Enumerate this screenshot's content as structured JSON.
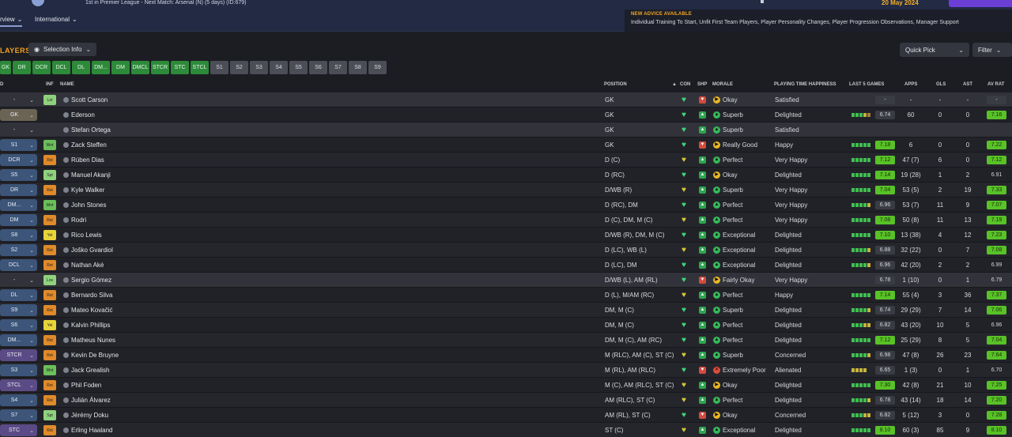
{
  "header": {
    "subtitle": "1st in Premier League - Next Match: Arsenal (N) (5 days) (ID:679)",
    "date": "20 May 2024",
    "tabs": [
      {
        "label": "rview",
        "has_dropdown": true
      },
      {
        "label": "International",
        "has_dropdown": true
      }
    ]
  },
  "advice": {
    "title": "NEW ADVICE AVAILABLE",
    "body": "Individual Training To Start, Unfit First Team Players, Player Personality Changes, Player Progression Observations, Manager Support"
  },
  "toolbar": {
    "title": "LAYERS",
    "selection_info": "Selection Info",
    "quick_pick": "Quick Pick",
    "filter": "Filter"
  },
  "chips": [
    {
      "label": "GK",
      "w": 14,
      "kind": "green"
    },
    {
      "label": "DR",
      "w": 23,
      "kind": "green"
    },
    {
      "label": "DCR",
      "w": 23,
      "kind": "green"
    },
    {
      "label": "DCL",
      "w": 23,
      "kind": "green"
    },
    {
      "label": "DL",
      "w": 23,
      "kind": "green"
    },
    {
      "label": "DM...",
      "w": 23,
      "kind": "green"
    },
    {
      "label": "DM",
      "w": 23,
      "kind": "green"
    },
    {
      "label": "DMCL",
      "w": 23,
      "kind": "green"
    },
    {
      "label": "STCR",
      "w": 23,
      "kind": "green"
    },
    {
      "label": "STC",
      "w": 23,
      "kind": "green"
    },
    {
      "label": "STCL",
      "w": 23,
      "kind": "green"
    },
    {
      "label": "S1",
      "w": 23,
      "kind": "grey"
    },
    {
      "label": "S2",
      "w": 23,
      "kind": "grey"
    },
    {
      "label": "S3",
      "w": 23,
      "kind": "grey"
    },
    {
      "label": "S4",
      "w": 23,
      "kind": "grey"
    },
    {
      "label": "S5",
      "w": 23,
      "kind": "grey"
    },
    {
      "label": "S6",
      "w": 23,
      "kind": "grey"
    },
    {
      "label": "S7",
      "w": 23,
      "kind": "grey"
    },
    {
      "label": "S8",
      "w": 23,
      "kind": "grey"
    },
    {
      "label": "S9",
      "w": 23,
      "kind": "grey"
    }
  ],
  "columns": {
    "sel": "D",
    "inf": "INF",
    "name": "NAME",
    "position": "POSITION",
    "sort": "▲",
    "con": "CON",
    "shp": "SHP",
    "morale": "MORALE",
    "pth": "PLAYING TIME HAPPINESS",
    "last5": "LAST 5 GAMES",
    "apps": "APPS",
    "gls": "GLS",
    "ast": "AST",
    "avrat": "AV RAT"
  },
  "players": [
    {
      "sel": "-",
      "selc": "dark",
      "inf": "Lst",
      "infc": "lgreen",
      "name": "Scott Carson",
      "pos": "GK",
      "con": "g",
      "shp": "down",
      "mc": "ok",
      "morale": "Okay",
      "pth": "Satisfied",
      "form": [],
      "rat": "-",
      "ratc": "mid",
      "apps": "-",
      "gls": "-",
      "ast": "-",
      "av": "-",
      "avc": "mid",
      "hl": true
    },
    {
      "sel": "GK",
      "selc": "grey",
      "inf": "",
      "infc": "",
      "name": "Ederson",
      "pos": "GK",
      "con": "g",
      "shp": "up",
      "mc": "good",
      "morale": "Superb",
      "pth": "Delighted",
      "form": [
        "g",
        "g",
        "g",
        "y",
        "o"
      ],
      "rat": "6.74",
      "ratc": "mid",
      "apps": "60",
      "gls": "0",
      "ast": "0",
      "av": "7.16",
      "avc": "hi"
    },
    {
      "sel": "-",
      "selc": "dark",
      "inf": "",
      "infc": "",
      "name": "Stefan Ortega",
      "pos": "GK",
      "con": "g",
      "shp": "up",
      "mc": "good",
      "morale": "Superb",
      "pth": "Satisfied",
      "form": [],
      "rat": "",
      "ratc": "none",
      "apps": "",
      "gls": "",
      "ast": "",
      "av": "",
      "avc": "none",
      "hl": true
    },
    {
      "sel": "S1",
      "selc": "blue",
      "inf": "Wnt",
      "infc": "green",
      "name": "Zack Steffen",
      "pos": "GK",
      "con": "g",
      "shp": "down",
      "mc": "ok",
      "morale": "Really Good",
      "pth": "Happy",
      "form": [
        "g",
        "g",
        "g",
        "g",
        "g"
      ],
      "rat": "7.18",
      "ratc": "hi",
      "apps": "6",
      "gls": "0",
      "ast": "0",
      "av": "7.22",
      "avc": "hi"
    },
    {
      "sel": "DCR",
      "selc": "blue",
      "inf": "Rst",
      "infc": "orange",
      "name": "Rúben Dias",
      "pos": "D (C)",
      "con": "y",
      "shp": "up",
      "mc": "good",
      "morale": "Perfect",
      "pth": "Very Happy",
      "form": [
        "g",
        "g",
        "g",
        "g",
        "g"
      ],
      "rat": "7.12",
      "ratc": "hi",
      "apps": "47 (7)",
      "gls": "6",
      "ast": "0",
      "av": "7.12",
      "avc": "hi"
    },
    {
      "sel": "S5",
      "selc": "blue",
      "inf": "Spt",
      "infc": "lgreen",
      "name": "Manuel Akanji",
      "pos": "D (RC)",
      "con": "g",
      "shp": "up",
      "mc": "ok",
      "morale": "Okay",
      "pth": "Delighted",
      "form": [
        "g",
        "g",
        "g",
        "g",
        "g"
      ],
      "rat": "7.14",
      "ratc": "hi",
      "apps": "19 (28)",
      "gls": "1",
      "ast": "2",
      "av": "6.91",
      "avc": "plain"
    },
    {
      "sel": "DR",
      "selc": "blue",
      "inf": "Rst",
      "infc": "orange",
      "name": "Kyle Walker",
      "pos": "D/WB (R)",
      "con": "y",
      "shp": "up",
      "mc": "good",
      "morale": "Superb",
      "pth": "Very Happy",
      "form": [
        "g",
        "g",
        "g",
        "g",
        "g"
      ],
      "rat": "7.04",
      "ratc": "hi",
      "apps": "53 (5)",
      "gls": "2",
      "ast": "19",
      "av": "7.33",
      "avc": "hi"
    },
    {
      "sel": "DM...",
      "selc": "blue",
      "inf": "Wnt",
      "infc": "green",
      "name": "John Stones",
      "pos": "D (RC), DM",
      "con": "g",
      "shp": "up",
      "mc": "good",
      "morale": "Perfect",
      "pth": "Very Happy",
      "form": [
        "g",
        "g",
        "g",
        "g",
        "y"
      ],
      "rat": "6.96",
      "ratc": "mid",
      "apps": "53 (7)",
      "gls": "11",
      "ast": "9",
      "av": "7.07",
      "avc": "hi"
    },
    {
      "sel": "DM",
      "selc": "blue",
      "inf": "Rst",
      "infc": "orange",
      "name": "Rodri",
      "pos": "D (C), DM, M (C)",
      "con": "y",
      "shp": "up",
      "mc": "good",
      "morale": "Perfect",
      "pth": "Very Happy",
      "form": [
        "g",
        "g",
        "g",
        "g",
        "g"
      ],
      "rat": "7.08",
      "ratc": "hi",
      "apps": "50 (8)",
      "gls": "11",
      "ast": "13",
      "av": "7.19",
      "avc": "hi"
    },
    {
      "sel": "S8",
      "selc": "blue",
      "inf": "Yel",
      "infc": "yellow",
      "name": "Rico Lewis",
      "pos": "D/WB (R), DM, M (C)",
      "con": "g",
      "shp": "up",
      "mc": "good",
      "morale": "Exceptional",
      "pth": "Delighted",
      "form": [
        "g",
        "g",
        "g",
        "g",
        "g"
      ],
      "rat": "7.10",
      "ratc": "hi",
      "apps": "13 (38)",
      "gls": "4",
      "ast": "12",
      "av": "7.23",
      "avc": "hi"
    },
    {
      "sel": "S2",
      "selc": "blue",
      "inf": "Rst",
      "infc": "orange",
      "name": "Joško Gvardiol",
      "pos": "D (LC), WB (L)",
      "con": "y",
      "shp": "up",
      "mc": "good",
      "morale": "Exceptional",
      "pth": "Delighted",
      "form": [
        "g",
        "g",
        "g",
        "g",
        "y"
      ],
      "rat": "6.88",
      "ratc": "mid",
      "apps": "32 (22)",
      "gls": "0",
      "ast": "7",
      "av": "7.08",
      "avc": "hi"
    },
    {
      "sel": "DCL",
      "selc": "blue",
      "inf": "Rst",
      "infc": "orange",
      "name": "Nathan Aké",
      "pos": "D (LC), DM",
      "con": "g",
      "shp": "up",
      "mc": "good",
      "morale": "Exceptional",
      "pth": "Delighted",
      "form": [
        "g",
        "g",
        "g",
        "g",
        "y"
      ],
      "rat": "6.96",
      "ratc": "mid",
      "apps": "42 (20)",
      "gls": "2",
      "ast": "2",
      "av": "6.99",
      "avc": "plain"
    },
    {
      "sel": "-",
      "selc": "dark",
      "inf": "Los",
      "infc": "lgreen",
      "name": "Sergio Gómez",
      "pos": "D/WB (L), AM (RL)",
      "con": "g",
      "shp": "down",
      "mc": "ok",
      "morale": "Fairly Okay",
      "pth": "Very Happy",
      "form": [],
      "rat": "6.78",
      "ratc": "mid",
      "apps": "1 (10)",
      "gls": "0",
      "ast": "1",
      "av": "6.79",
      "avc": "plain",
      "hl": true
    },
    {
      "sel": "DL",
      "selc": "blue",
      "inf": "Rst",
      "infc": "orange",
      "name": "Bernardo Silva",
      "pos": "D (L), M/AM (RC)",
      "con": "y",
      "shp": "up",
      "mc": "good",
      "morale": "Perfect",
      "pth": "Happy",
      "form": [
        "g",
        "g",
        "g",
        "g",
        "g"
      ],
      "rat": "7.14",
      "ratc": "hi",
      "apps": "55 (4)",
      "gls": "3",
      "ast": "36",
      "av": "7.37",
      "avc": "hi"
    },
    {
      "sel": "S9",
      "selc": "blue",
      "inf": "Rst",
      "infc": "orange",
      "name": "Mateo Kovačić",
      "pos": "DM, M (C)",
      "con": "g",
      "shp": "up",
      "mc": "good",
      "morale": "Superb",
      "pth": "Delighted",
      "form": [
        "g",
        "g",
        "g",
        "g",
        "y"
      ],
      "rat": "6.74",
      "ratc": "mid",
      "apps": "29 (29)",
      "gls": "7",
      "ast": "14",
      "av": "7.06",
      "avc": "hi"
    },
    {
      "sel": "S6",
      "selc": "blue",
      "inf": "Yel",
      "infc": "yellow",
      "name": "Kalvin Phillips",
      "pos": "DM, M (C)",
      "con": "g",
      "shp": "up",
      "mc": "good",
      "morale": "Perfect",
      "pth": "Delighted",
      "form": [
        "g",
        "g",
        "g",
        "y",
        "y"
      ],
      "rat": "6.82",
      "ratc": "mid",
      "apps": "43 (20)",
      "gls": "10",
      "ast": "5",
      "av": "6.96",
      "avc": "plain"
    },
    {
      "sel": "DM...",
      "selc": "blue",
      "inf": "Rst",
      "infc": "orange",
      "name": "Matheus Nunes",
      "pos": "DM, M (C), AM (RC)",
      "con": "g",
      "shp": "up",
      "mc": "good",
      "morale": "Perfect",
      "pth": "Delighted",
      "form": [
        "g",
        "g",
        "g",
        "g",
        "g"
      ],
      "rat": "7.12",
      "ratc": "hi",
      "apps": "25 (29)",
      "gls": "8",
      "ast": "5",
      "av": "7.04",
      "avc": "hi"
    },
    {
      "sel": "STCR",
      "selc": "purple",
      "inf": "Rst",
      "infc": "orange",
      "name": "Kevin De Bruyne",
      "pos": "M (RLC), AM (C), ST (C)",
      "con": "y",
      "shp": "up",
      "mc": "good",
      "morale": "Superb",
      "pth": "Concerned",
      "form": [
        "g",
        "g",
        "g",
        "g",
        "y"
      ],
      "rat": "6.98",
      "ratc": "mid",
      "apps": "47 (8)",
      "gls": "26",
      "ast": "23",
      "av": "7.64",
      "avc": "hi"
    },
    {
      "sel": "S3",
      "selc": "blue",
      "inf": "Wnt",
      "infc": "green",
      "name": "Jack Grealish",
      "pos": "M (RL), AM (RLC)",
      "con": "g",
      "shp": "down",
      "mc": "bad",
      "morale": "Extremely Poor",
      "pth": "Alienated",
      "form": [
        "y",
        "y",
        "y",
        "y"
      ],
      "rat": "6.65",
      "ratc": "mid",
      "apps": "1 (3)",
      "gls": "0",
      "ast": "1",
      "av": "6.70",
      "avc": "plain"
    },
    {
      "sel": "STCL",
      "selc": "purple",
      "inf": "Rst",
      "infc": "orange",
      "name": "Phil Foden",
      "pos": "M (C), AM (RLC), ST (C)",
      "con": "y",
      "shp": "up",
      "mc": "ok",
      "morale": "Okay",
      "pth": "Delighted",
      "form": [
        "g",
        "g",
        "g",
        "g",
        "g"
      ],
      "rat": "7.30",
      "ratc": "hi",
      "apps": "42 (8)",
      "gls": "21",
      "ast": "10",
      "av": "7.25",
      "avc": "hi"
    },
    {
      "sel": "S4",
      "selc": "blue",
      "inf": "Rst",
      "infc": "orange",
      "name": "Julián Álvarez",
      "pos": "AM (RLC), ST (C)",
      "con": "y",
      "shp": "up",
      "mc": "good",
      "morale": "Perfect",
      "pth": "Delighted",
      "form": [
        "g",
        "g",
        "g",
        "g",
        "y"
      ],
      "rat": "6.78",
      "ratc": "mid",
      "apps": "43 (14)",
      "gls": "18",
      "ast": "14",
      "av": "7.20",
      "avc": "hi"
    },
    {
      "sel": "S7",
      "selc": "blue",
      "inf": "Spt",
      "infc": "lgreen",
      "name": "Jérémy Doku",
      "pos": "AM (RL), ST (C)",
      "con": "g",
      "shp": "down",
      "mc": "ok",
      "morale": "Okay",
      "pth": "Concerned",
      "form": [
        "g",
        "g",
        "g",
        "y",
        "y"
      ],
      "rat": "6.82",
      "ratc": "mid",
      "apps": "5 (12)",
      "gls": "3",
      "ast": "0",
      "av": "7.28",
      "avc": "hi"
    },
    {
      "sel": "STC",
      "selc": "purple",
      "inf": "Rst",
      "infc": "orange",
      "name": "Erling Haaland",
      "pos": "ST (C)",
      "con": "y",
      "shp": "up",
      "mc": "good",
      "morale": "Exceptional",
      "pth": "Delighted",
      "form": [
        "g",
        "g",
        "g",
        "g",
        "g"
      ],
      "rat": "8.10",
      "ratc": "hi",
      "apps": "60 (3)",
      "gls": "85",
      "ast": "9",
      "av": "8.10",
      "avc": "hi"
    }
  ]
}
